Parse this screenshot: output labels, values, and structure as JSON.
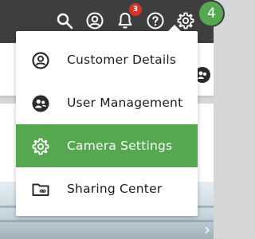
{
  "topbar": {
    "notifications_count": "3",
    "avatar_initial": "4"
  },
  "menu": {
    "items": [
      {
        "label": "Customer Details",
        "icon": "person-circle-icon",
        "active": false
      },
      {
        "label": "User Management",
        "icon": "users-icon",
        "active": false
      },
      {
        "label": "Camera Settings",
        "icon": "gear-icon",
        "active": true
      },
      {
        "label": "Sharing Center",
        "icon": "folder-link-icon",
        "active": false
      }
    ]
  },
  "colors": {
    "topbar": "#3e3e3e",
    "accent_green": "#55a850",
    "badge_red": "#d9322b"
  }
}
